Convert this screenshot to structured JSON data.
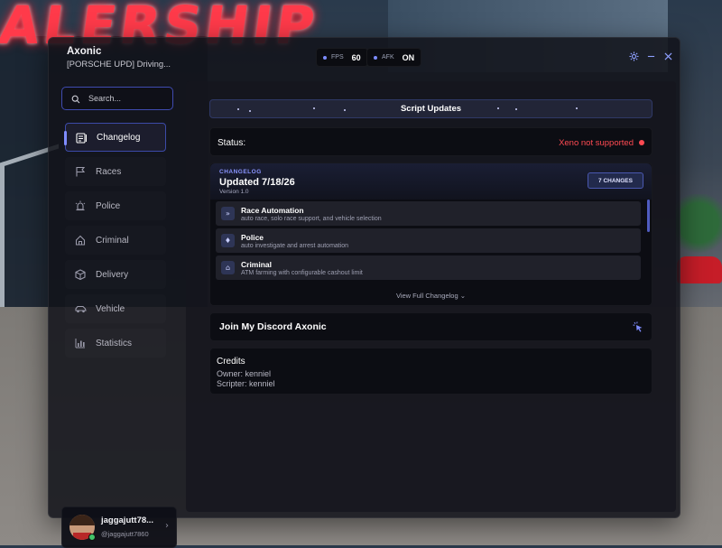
{
  "window": {
    "title": "Axonic",
    "subtitle": "[PORSCHE UPD] Driving...",
    "stats": [
      {
        "label": "FPS",
        "value": "60"
      },
      {
        "label": "AFK",
        "value": "ON"
      }
    ],
    "controls": [
      "settings",
      "minimize",
      "close"
    ]
  },
  "sidebar": {
    "search_placeholder": "Search...",
    "items": [
      {
        "label": "Changelog",
        "icon": "changelog-icon",
        "active": true
      },
      {
        "label": "Races",
        "icon": "flag-icon",
        "active": false
      },
      {
        "label": "Police",
        "icon": "siren-icon",
        "active": false
      },
      {
        "label": "Criminal",
        "icon": "house-icon",
        "active": false
      },
      {
        "label": "Delivery",
        "icon": "box-icon",
        "active": false
      },
      {
        "label": "Vehicle",
        "icon": "car-icon",
        "active": false
      },
      {
        "label": "Statistics",
        "icon": "bar-chart-icon",
        "active": false
      }
    ],
    "profile": {
      "name": "jaggajutt78...",
      "handle": "@jaggajutt7860"
    }
  },
  "main": {
    "header": "Script Updates",
    "status": {
      "label": "Status:",
      "value": "Xeno not supported",
      "color": "#ff4a52"
    },
    "changelog": {
      "tag": "CHANGELOG",
      "title": "Updated 7/18/26",
      "version": "Version 1.0",
      "changes_button": "7 CHANGES",
      "items": [
        {
          "name": "Race Automation",
          "desc": "auto race, solo race support, and vehicle selection",
          "icon": "race-icon"
        },
        {
          "name": "Police",
          "desc": "auto investigate and arrest automation",
          "icon": "badge-icon"
        },
        {
          "name": "Criminal",
          "desc": "ATM farming with configurable cashout limit",
          "icon": "house-icon"
        }
      ],
      "view_full": "View Full Changelog"
    },
    "discord": {
      "label": "Join My Discord Axonic"
    },
    "credits": {
      "title": "Credits",
      "owner": "Owner: kenniel",
      "scripter": "Scripter: kenniel"
    }
  },
  "colors": {
    "accent": "#7f8cff",
    "error": "#ff4a52",
    "online": "#43c46a"
  }
}
